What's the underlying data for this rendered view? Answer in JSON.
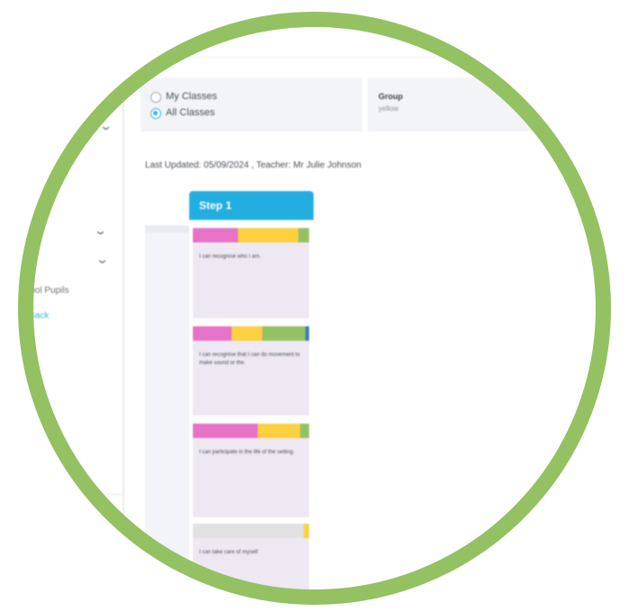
{
  "filters": {
    "options": [
      {
        "label": "My Classes",
        "selected": false
      },
      {
        "label": "All Classes",
        "selected": true
      }
    ]
  },
  "group": {
    "title": "Group",
    "value": "yellow"
  },
  "meta": {
    "line": "Last Updated: 05/09/2024 , Teacher: Mr Julie Johnson"
  },
  "sidebar": {
    "labels": [
      "School Pupils",
      "Back"
    ]
  },
  "step": {
    "title": "Step 1",
    "cards": [
      {
        "text": "I can recognise who I am.",
        "segments": [
          {
            "color": "#e673c7",
            "pct": 39
          },
          {
            "color": "#fcd03f",
            "pct": 52
          },
          {
            "color": "#94c162",
            "pct": 9
          }
        ]
      },
      {
        "text": "I can recognise that I can do movement to make sound or the.",
        "segments": [
          {
            "color": "#e673c7",
            "pct": 33
          },
          {
            "color": "#fcd03f",
            "pct": 27
          },
          {
            "color": "#94c162",
            "pct": 37
          },
          {
            "color": "#3b78c0",
            "pct": 3
          }
        ]
      },
      {
        "text": "I can participate in the life of the setting.",
        "segments": [
          {
            "color": "#e673c7",
            "pct": 56
          },
          {
            "color": "#fcd03f",
            "pct": 36
          },
          {
            "color": "#94c162",
            "pct": 8
          }
        ]
      },
      {
        "text": "I can take care of myself",
        "segments": [
          {
            "color": "#e1e1e4",
            "pct": 95
          },
          {
            "color": "#fcd03f",
            "pct": 5
          }
        ]
      }
    ]
  },
  "colors": {
    "ring": "#94c162",
    "accent": "#22aee0",
    "pink": "#e673c7",
    "yellow": "#fcd03f",
    "green": "#94c162",
    "blue": "#3b78c0"
  },
  "icons": [
    "chevron-down-icon",
    "radio-button-icon"
  ]
}
